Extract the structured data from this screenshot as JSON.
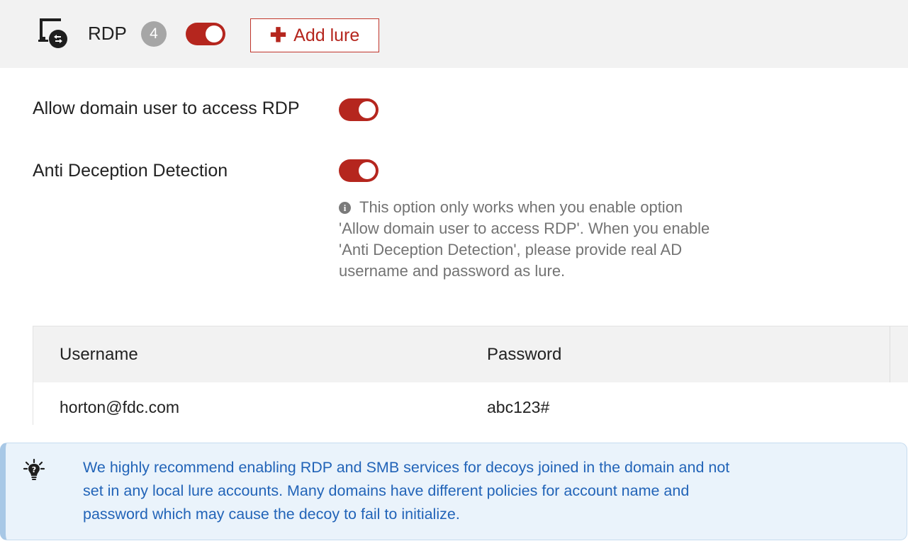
{
  "header": {
    "service_icon": "remote-desktop-icon",
    "title": "RDP",
    "lure_count": "4",
    "service_enabled": true,
    "add_lure_label": "Add lure",
    "add_lure_icon": "plus-icon"
  },
  "settings": {
    "allow_domain_user": {
      "label": "Allow domain user to access RDP",
      "enabled": true
    },
    "anti_deception": {
      "label": "Anti Deception Detection",
      "enabled": true,
      "help_icon": "info-icon",
      "help_lines": [
        "This option only works when you enable option",
        "'Allow domain user to access RDP'. When you enable",
        "'Anti Deception Detection', please provide real AD",
        "username and password as lure."
      ]
    }
  },
  "lure_table": {
    "columns": [
      "Username",
      "Password"
    ],
    "rows": [
      {
        "username": "horton@fdc.com",
        "password": "abc123#"
      }
    ]
  },
  "note": {
    "icon": "lightbulb-icon",
    "lines": [
      "We highly recommend enabling RDP and SMB services for decoys joined in the domain and not",
      "set in any local lure accounts. Many domains have different policies for account name and",
      "password which may cause the decoy to fail to initialize."
    ]
  },
  "colors": {
    "accent_red": "#b5261e",
    "badge_gray": "#a6a6a6",
    "header_bg": "#f2f2f2",
    "note_bg": "#eaf3fb",
    "note_text": "#2264b8"
  }
}
